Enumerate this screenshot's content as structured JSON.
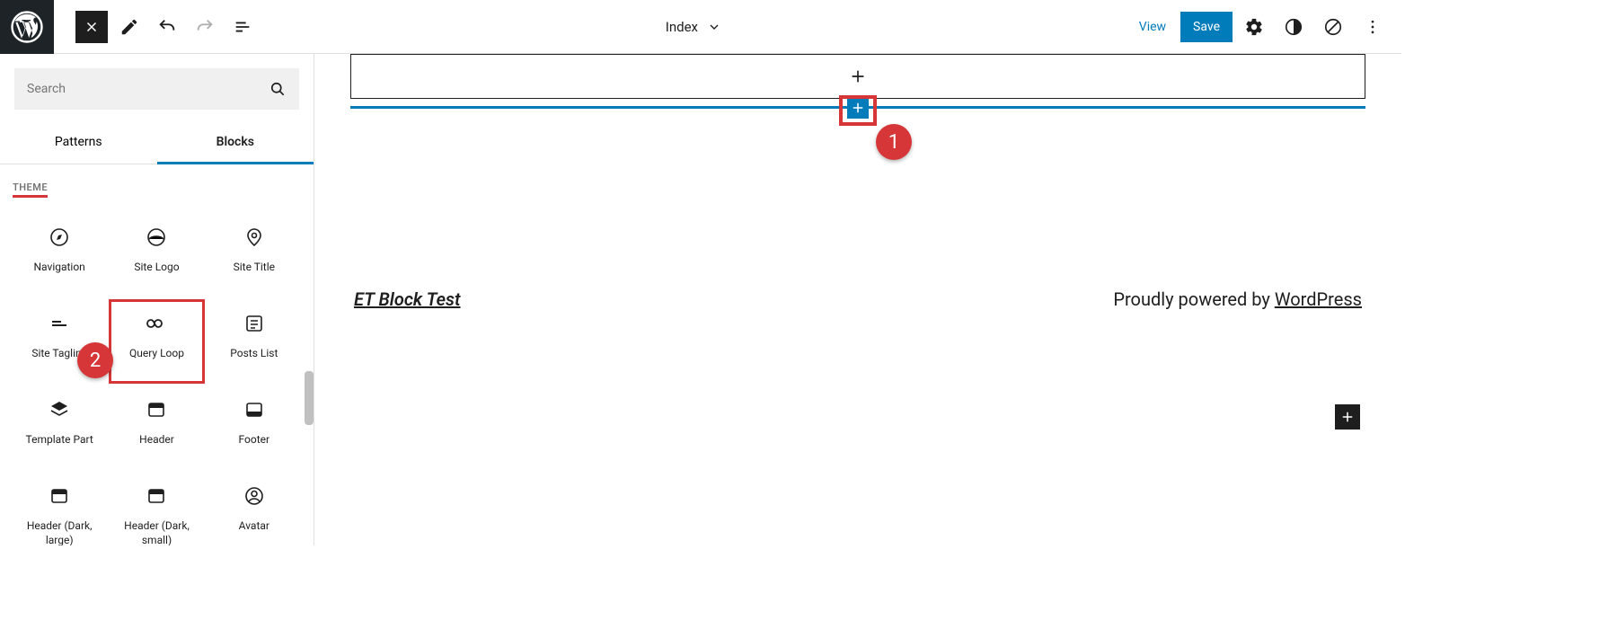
{
  "topbar": {
    "doc_title": "Index",
    "view_label": "View",
    "save_label": "Save"
  },
  "sidebar": {
    "search_placeholder": "Search",
    "tabs": {
      "patterns": "Patterns",
      "blocks": "Blocks"
    },
    "section_title": "THEME",
    "blocks": [
      {
        "label": "Navigation"
      },
      {
        "label": "Site Logo"
      },
      {
        "label": "Site Title"
      },
      {
        "label": "Site Tagline"
      },
      {
        "label": "Query Loop"
      },
      {
        "label": "Posts List"
      },
      {
        "label": "Template Part"
      },
      {
        "label": "Header"
      },
      {
        "label": "Footer"
      },
      {
        "label": "Header (Dark, large)"
      },
      {
        "label": "Header (Dark, small)"
      },
      {
        "label": "Avatar"
      }
    ]
  },
  "canvas": {
    "site_name": "ET Block Test",
    "powered_prefix": "Proudly powered by ",
    "powered_link": "WordPress"
  },
  "annotations": {
    "badge1": "1",
    "badge2": "2"
  }
}
